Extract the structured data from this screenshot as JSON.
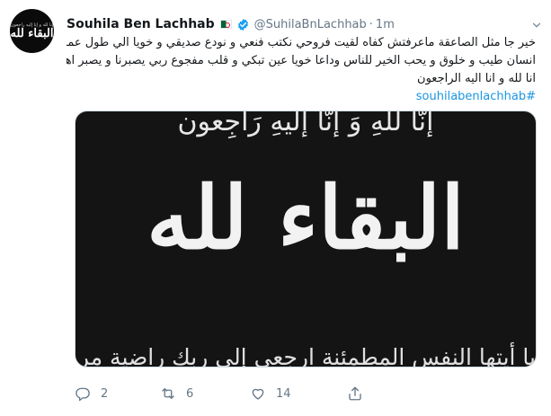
{
  "tweet": {
    "display_name": "Souhila Ben Lachhab",
    "handle": "@SuhilaBnLachhab",
    "separator": "·",
    "time": "1m",
    "text_lines": [
      "خير جا مثل الصاعقة ماعرفتش كفاه لقيت فروحي نكتب فنعي و نودع صديقي و خويا  الي طول عمرو",
      "انسان طيب و خلوق و يحب الخير للناس وداعا خويا عين تبكي و قلب مفجوع ربي يصبرنا و يصبر اهلك",
      "انا لله و انا اليه الراجعون"
    ],
    "hashtag": "#souhilabenlachhab",
    "image": {
      "top_text": "إنّا للهِ وَ إنّا إليهِ رَاجِعون",
      "main_text": "البقاء لله",
      "bottom_text": "يا أيتها النفس المطمئنة ارجعي إلى ربك راضية مرضية"
    },
    "avatar": {
      "small_text": "إنا لله و إنا إليه راجعون",
      "big_text": "البقاء لله"
    },
    "counts": {
      "replies": "2",
      "retweets": "6",
      "likes": "14"
    }
  },
  "icons": {
    "verified": "verified-badge-icon",
    "flag": "algeria-flag-icon",
    "more": "chevron-down-icon",
    "reply": "reply-icon",
    "retweet": "retweet-icon",
    "like": "heart-icon",
    "share": "share-icon"
  },
  "colors": {
    "link": "#1b95e0",
    "muted": "#657786",
    "verified": "#1da1f2",
    "text": "#14171a"
  }
}
